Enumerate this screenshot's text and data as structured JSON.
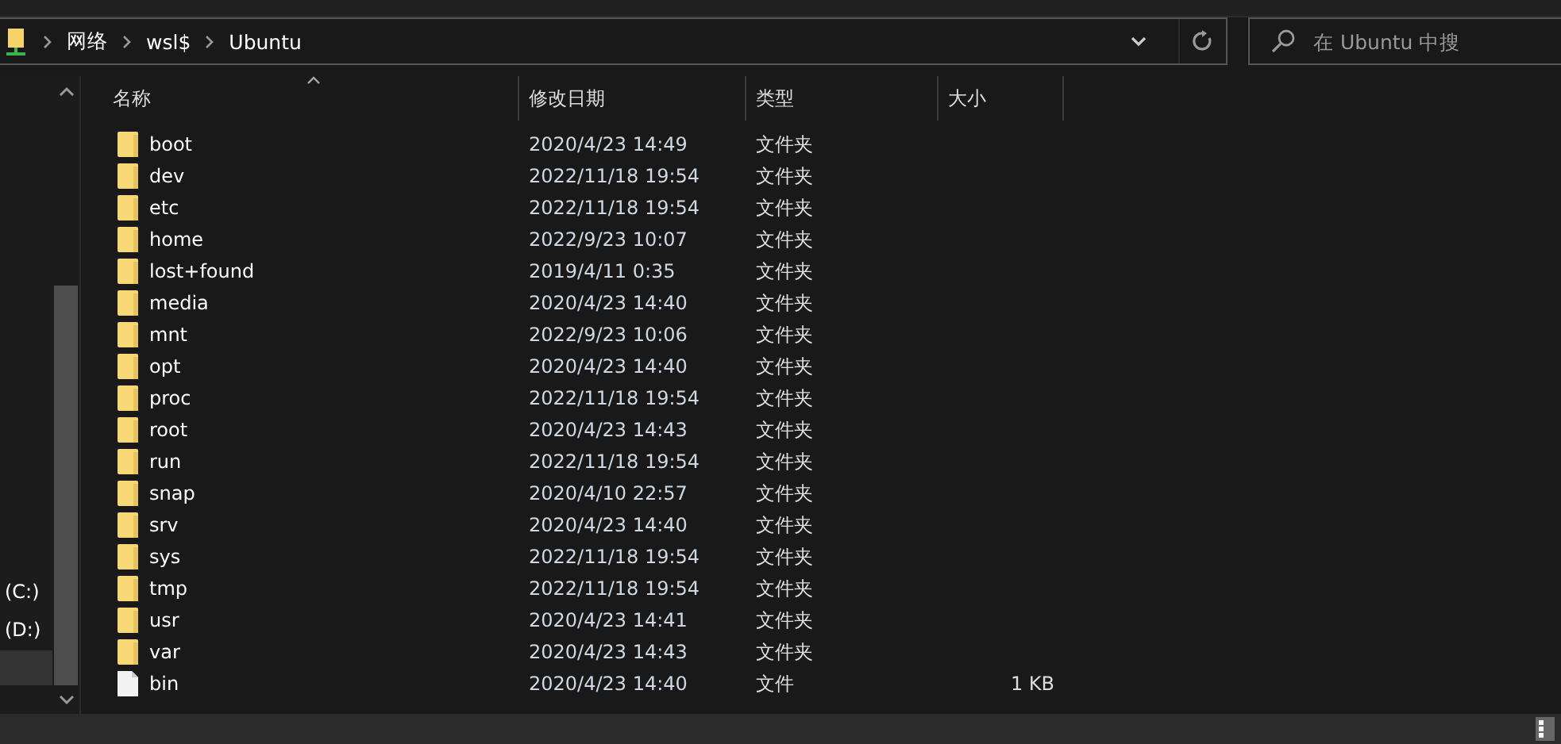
{
  "address_bar": {
    "path": [
      "网络",
      "wsl$",
      "Ubuntu"
    ]
  },
  "search": {
    "placeholder": "在 Ubuntu 中搜"
  },
  "nav_pane": {
    "items": [
      {
        "label": "(C:)",
        "selected": false
      },
      {
        "label": "(D:)",
        "selected": false
      },
      {
        "selected": true
      }
    ]
  },
  "table": {
    "columns": [
      "名称",
      "修改日期",
      "类型",
      "大小"
    ],
    "rows": [
      {
        "name": "boot",
        "date": "2020/4/23 14:49",
        "type": "文件夹",
        "kind": "folder"
      },
      {
        "name": "dev",
        "date": "2022/11/18 19:54",
        "type": "文件夹",
        "kind": "folder"
      },
      {
        "name": "etc",
        "date": "2022/11/18 19:54",
        "type": "文件夹",
        "kind": "folder"
      },
      {
        "name": "home",
        "date": "2022/9/23 10:07",
        "type": "文件夹",
        "kind": "folder"
      },
      {
        "name": "lost+found",
        "date": "2019/4/11 0:35",
        "type": "文件夹",
        "kind": "folder"
      },
      {
        "name": "media",
        "date": "2020/4/23 14:40",
        "type": "文件夹",
        "kind": "folder"
      },
      {
        "name": "mnt",
        "date": "2022/9/23 10:06",
        "type": "文件夹",
        "kind": "folder"
      },
      {
        "name": "opt",
        "date": "2020/4/23 14:40",
        "type": "文件夹",
        "kind": "folder"
      },
      {
        "name": "proc",
        "date": "2022/11/18 19:54",
        "type": "文件夹",
        "kind": "folder"
      },
      {
        "name": "root",
        "date": "2020/4/23 14:43",
        "type": "文件夹",
        "kind": "folder"
      },
      {
        "name": "run",
        "date": "2022/11/18 19:54",
        "type": "文件夹",
        "kind": "folder"
      },
      {
        "name": "snap",
        "date": "2020/4/10 22:57",
        "type": "文件夹",
        "kind": "folder"
      },
      {
        "name": "srv",
        "date": "2020/4/23 14:40",
        "type": "文件夹",
        "kind": "folder"
      },
      {
        "name": "sys",
        "date": "2022/11/18 19:54",
        "type": "文件夹",
        "kind": "folder"
      },
      {
        "name": "tmp",
        "date": "2022/11/18 19:54",
        "type": "文件夹",
        "kind": "folder"
      },
      {
        "name": "usr",
        "date": "2020/4/23 14:41",
        "type": "文件夹",
        "kind": "folder"
      },
      {
        "name": "var",
        "date": "2020/4/23 14:43",
        "type": "文件夹",
        "kind": "folder"
      },
      {
        "name": "bin",
        "date": "2020/4/23 14:40",
        "type": "文件",
        "size": "1 KB",
        "kind": "file"
      }
    ]
  }
}
